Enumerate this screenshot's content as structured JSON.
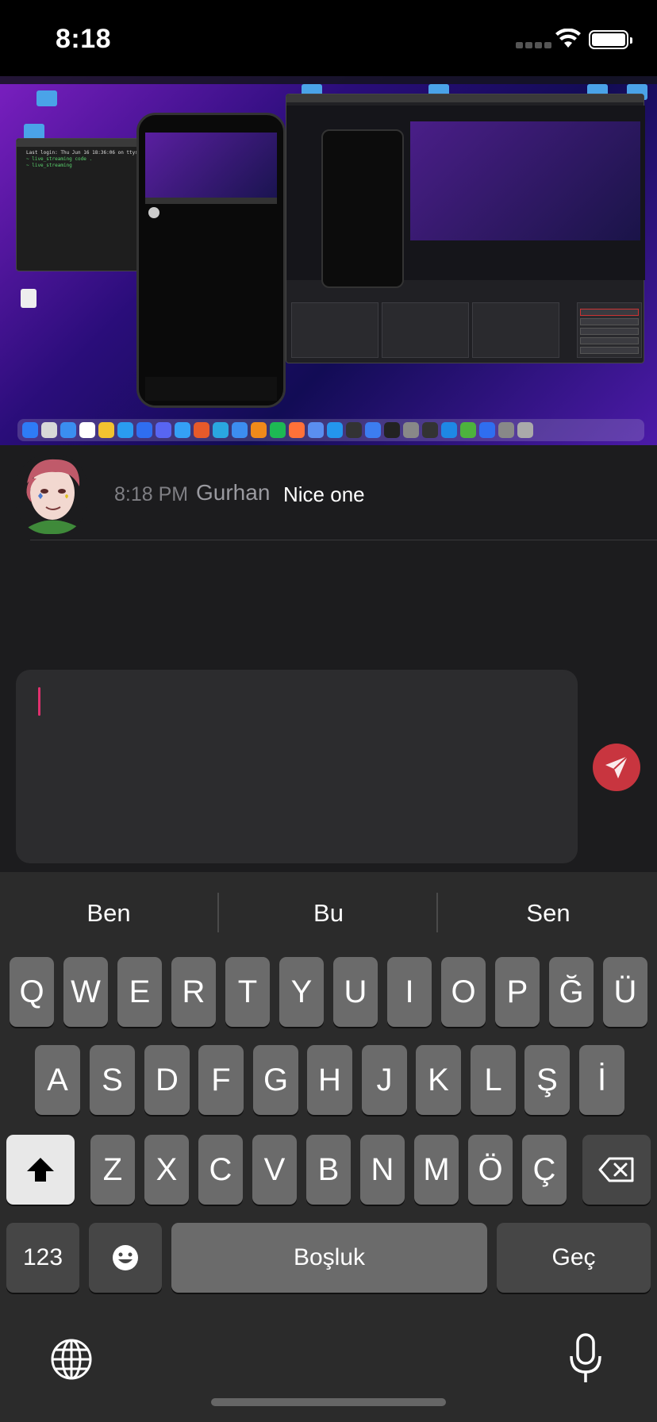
{
  "status_bar": {
    "time": "8:18"
  },
  "stream_preview": {
    "terminal_lines": [
      "Last login: Thu Jun 16 18:36:06 on ttys000",
      "~ live_streaming code .",
      "~ live_streaming"
    ]
  },
  "message": {
    "time": "8:18 PM",
    "username": "Gurhan",
    "text": "Nice one"
  },
  "keyboard": {
    "suggestions": [
      "Ben",
      "Bu",
      "Sen"
    ],
    "row1": [
      "Q",
      "W",
      "E",
      "R",
      "T",
      "Y",
      "U",
      "I",
      "O",
      "P",
      "Ğ",
      "Ü"
    ],
    "row2": [
      "A",
      "S",
      "D",
      "F",
      "G",
      "H",
      "J",
      "K",
      "L",
      "Ş",
      "İ"
    ],
    "row3": [
      "Z",
      "X",
      "C",
      "V",
      "B",
      "N",
      "M",
      "Ö",
      "Ç"
    ],
    "numbers_label": "123",
    "space_label": "Boşluk",
    "return_label": "Geç"
  },
  "icons": {
    "send": "paper-plane-icon",
    "shift": "shift-arrow-icon",
    "delete": "backspace-icon",
    "emoji": "emoji-face-icon",
    "globe": "globe-icon",
    "mic": "microphone-icon"
  },
  "colors": {
    "accent": "#e0306e",
    "send_button": "#c8353f",
    "background": "#1c1c1e",
    "keyboard": "#2b2b2b"
  }
}
